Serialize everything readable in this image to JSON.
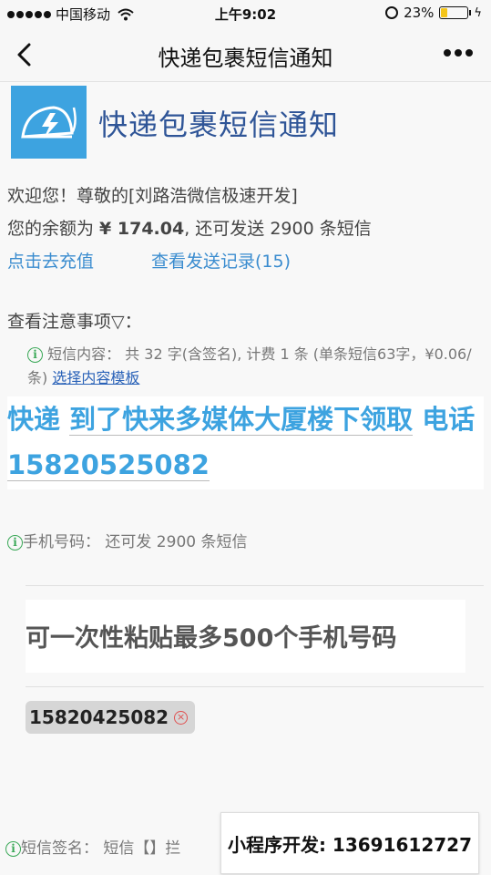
{
  "status_bar": {
    "carrier": "中国移动",
    "time": "上午9:02",
    "battery_percent": "23%",
    "battery_level": 0.23
  },
  "nav": {
    "title": "快递包裹短信通知"
  },
  "header": {
    "app_name": "快递包裹短信通知",
    "logo_icon": "envelope-bolt-icon",
    "brand_color": "#3da3e0"
  },
  "account": {
    "welcome": "欢迎您！尊敬的[刘路浩微信极速开发]",
    "balance_prefix": "您的余额为 ",
    "balance_amount": "¥ 174.04",
    "balance_suffix": ", 还可发送 2900 条短信",
    "recharge_link": "点击去充值",
    "history_link": "查看发送记录(15)"
  },
  "notice": {
    "title": "查看注意事项▽："
  },
  "sms": {
    "info_text": "短信内容：  共 32 字(含签名), 计费 1 条 (单条短信63字，¥0.06/条)",
    "template_link": "选择内容模板",
    "segments": {
      "s1": "快递",
      "f1": "到了快来多媒体大厦楼下领取",
      "s2": "电话",
      "f2": "15820525082"
    }
  },
  "phone": {
    "label": "手机号码：  还可发 2900 条短信",
    "paste_placeholder": "可一次性粘贴最多500个手机号码",
    "chips": [
      "15820425082"
    ]
  },
  "signature": {
    "label": "短信签名：  短信【】拦"
  },
  "watermark": {
    "text": "小程序开发:  13691612727"
  }
}
